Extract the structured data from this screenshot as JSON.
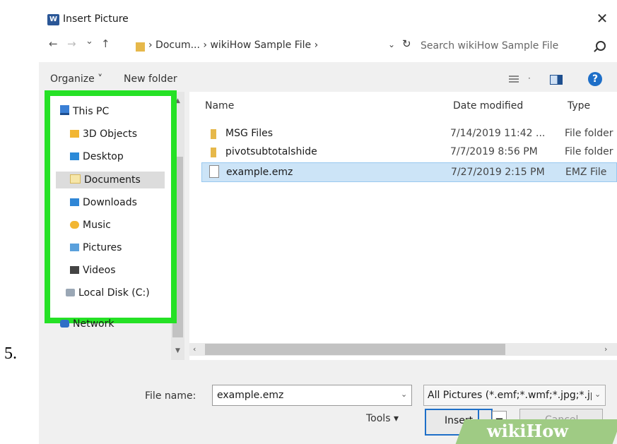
{
  "step_number": "5.",
  "dialog": {
    "title": "Insert Picture",
    "close_glyph": "✕",
    "app_icon": "word-icon"
  },
  "address": {
    "back": "←",
    "forward": "→",
    "recent": "⌄",
    "up": "↑",
    "path": "› Docum... › wikiHow Sample File ›",
    "dropdown": "⌄",
    "refresh": "↻",
    "search_placeholder": "Search wikiHow Sample File"
  },
  "toolbar": {
    "organize": "Organize ˅",
    "new_folder": "New folder",
    "view_dropdown": "·",
    "help": "?"
  },
  "nav": {
    "items": [
      {
        "label": "This PC",
        "icon": "this-pc-icon"
      },
      {
        "label": "3D Objects",
        "icon": "3d-objects-icon"
      },
      {
        "label": "Desktop",
        "icon": "desktop-icon"
      },
      {
        "label": "Documents",
        "icon": "documents-icon",
        "selected": true
      },
      {
        "label": "Downloads",
        "icon": "downloads-icon"
      },
      {
        "label": "Music",
        "icon": "music-icon"
      },
      {
        "label": "Pictures",
        "icon": "pictures-icon"
      },
      {
        "label": "Videos",
        "icon": "videos-icon"
      },
      {
        "label": "Local Disk (C:)",
        "icon": "local-disk-icon"
      },
      {
        "label": "Network",
        "icon": "network-icon"
      }
    ],
    "scroll_up": "▲",
    "scroll_down": "▼"
  },
  "files": {
    "columns": [
      "Name",
      "Date modified",
      "Type"
    ],
    "rows": [
      {
        "name": "MSG Files",
        "date": "7/14/2019 11:42 ...",
        "type": "File folder",
        "icon": "folder-icon"
      },
      {
        "name": "pivotsubtotalshide",
        "date": "7/7/2019 8:56 PM",
        "type": "File folder",
        "icon": "folder-icon"
      },
      {
        "name": "example.emz",
        "date": "7/27/2019 2:15 PM",
        "type": "EMZ File",
        "icon": "file-icon",
        "selected": true
      }
    ],
    "hscroll_left": "‹",
    "hscroll_right": "›"
  },
  "bottom": {
    "file_name_label": "File name:",
    "file_name_value": "example.emz",
    "file_name_dropdown": "⌄",
    "filter_value": "All Pictures (*.emf;*.wmf;*.jpg;*.jp",
    "filter_dropdown": "⌄",
    "tools": "Tools ▾",
    "insert": "Insert",
    "insert_arrow": "▼",
    "cancel": "Cancel"
  },
  "watermark": "wikiHow"
}
